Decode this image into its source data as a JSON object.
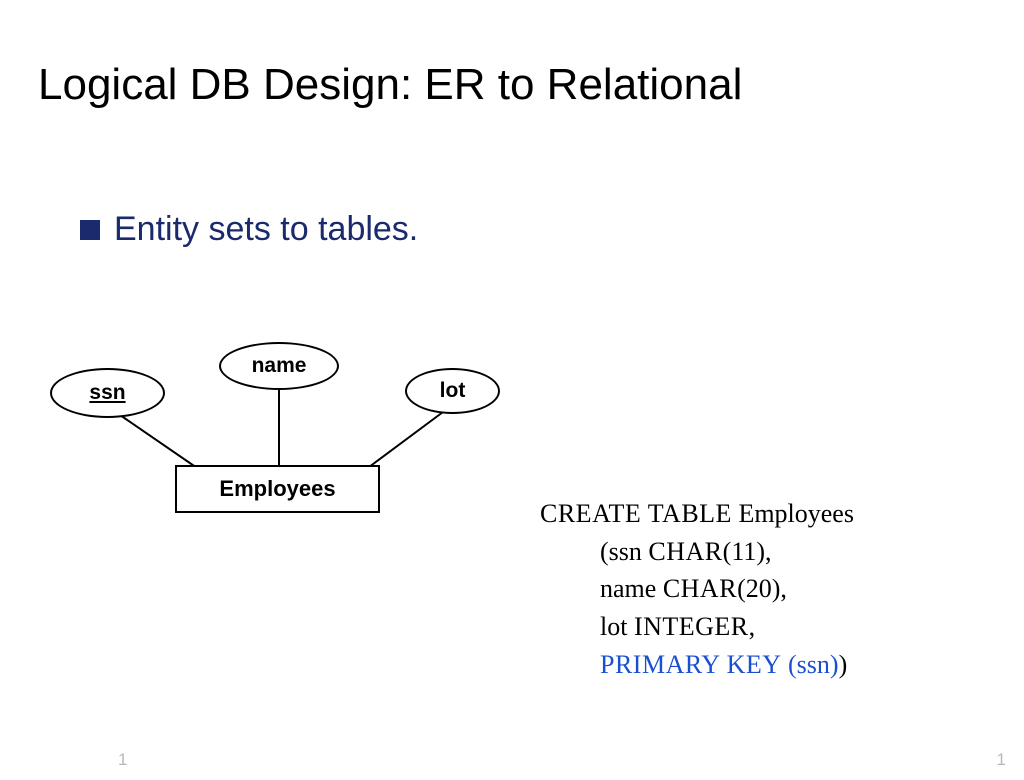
{
  "title": "Logical DB Design: ER to Relational",
  "bullet": {
    "text": "Entity sets to tables."
  },
  "er": {
    "attr_ssn": "ssn",
    "attr_name": "name",
    "attr_lot": "lot",
    "entity": "Employees"
  },
  "sql": {
    "l1_kw": "CREATE TABLE",
    "l1_ident": " Employees",
    "l2_open": "(ssn ",
    "l2_type": "CHAR",
    "l2_rest": "(11),",
    "l3_a": "name ",
    "l3_type": "CHAR",
    "l3_rest": "(20),",
    "l4_a": "lot  ",
    "l4_type": "INTEGER",
    "l4_rest": ",",
    "l5_pk": "PRIMARY KEY",
    "l5_arg": "  (ssn)",
    "l5_close": ")"
  },
  "page": {
    "left": "1",
    "right": "1"
  }
}
